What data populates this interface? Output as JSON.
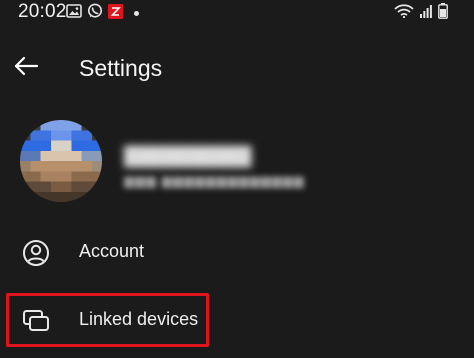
{
  "status_bar": {
    "time": "20:02",
    "left_icons": [
      "image-icon",
      "whatsapp-icon",
      "app-notification-icon",
      "notification-dot-icon"
    ],
    "right_icons": [
      "wifi-icon",
      "signal-icon",
      "battery-icon"
    ],
    "notification_badge_color": "#e0141c"
  },
  "header": {
    "back_icon": "arrow-left-icon",
    "title": "Settings"
  },
  "profile": {
    "avatar": "avatar-icon",
    "name_pixelated": true,
    "phone_pixelated": true
  },
  "menu": {
    "items": [
      {
        "label": "Account",
        "icon": "account-circle-icon"
      },
      {
        "label": "Linked devices",
        "icon": "linked-devices-icon",
        "highlighted": true
      }
    ]
  },
  "colors": {
    "background": "#1b1b1b",
    "text": "#ffffff",
    "highlight": "#e0141c"
  }
}
